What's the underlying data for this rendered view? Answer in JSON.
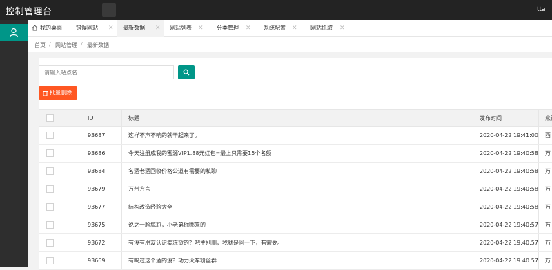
{
  "app": {
    "title": "控制管理台",
    "user": "tta"
  },
  "tabs": [
    {
      "label": "我的桌面",
      "closable": false
    },
    {
      "label": "错误网站",
      "closable": true
    },
    {
      "label": "最新数据",
      "closable": true,
      "active": true
    },
    {
      "label": "网站列表",
      "closable": true
    },
    {
      "label": "分类管理",
      "closable": true
    },
    {
      "label": "系统配置",
      "closable": true
    },
    {
      "label": "网站抓取",
      "closable": true
    }
  ],
  "breadcrumb": [
    "首页",
    "网站管理",
    "最新数据"
  ],
  "breadcrumb_sep": "/",
  "search": {
    "placeholder": "请输入站点名"
  },
  "batch_delete_label": "批量删除",
  "table": {
    "headers": {
      "id": "ID",
      "title": "标题",
      "date": "发布时间",
      "source": "来源"
    },
    "rows": [
      {
        "id": "93687",
        "title": "这样不声不响的就干起来了。",
        "date": "2020-04-22 19:41:00",
        "source": "西"
      },
      {
        "id": "93686",
        "title": "今天注册成我的蜜源VIP1.88元红包=最上只需要15个名额",
        "date": "2020-04-22 19:40:58",
        "source": "万"
      },
      {
        "id": "93684",
        "title": "名酒老酒回收价格公道有需要的私聊",
        "date": "2020-04-22 19:40:58",
        "source": "万"
      },
      {
        "id": "93679",
        "title": "万州方言",
        "date": "2020-04-22 19:40:58",
        "source": "万"
      },
      {
        "id": "93677",
        "title": "结构改造经验大全",
        "date": "2020-04-22 19:40:58",
        "source": "万"
      },
      {
        "id": "93675",
        "title": "说之一脸尴尬，小老弟你哪来的",
        "date": "2020-04-22 19:40:57",
        "source": "万"
      },
      {
        "id": "93672",
        "title": "有没有朋友认识卖冻货的？吧主别删，我就是问一下，有需要。",
        "date": "2020-04-22 19:40:57",
        "source": "万"
      },
      {
        "id": "93669",
        "title": "有喝过这个酒的没？动力火车粉丝群",
        "date": "2020-04-22 19:40:57",
        "source": "万"
      }
    ]
  },
  "colors": {
    "topbar": "#232323",
    "accent": "#009688",
    "danger": "#ff5722"
  },
  "icons": [
    "menu-icon",
    "user-icon",
    "home-icon",
    "close-icon",
    "search-icon",
    "trash-icon"
  ]
}
